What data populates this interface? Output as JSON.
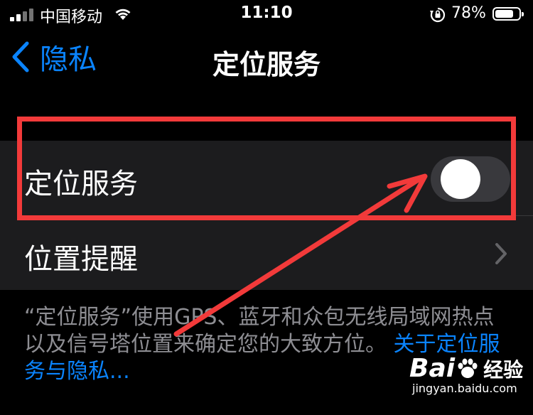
{
  "status_bar": {
    "carrier": "中国移动",
    "time": "11:10",
    "battery_percent": "78%",
    "battery_level": 0.78,
    "icons": [
      "signal-icon",
      "wifi-icon",
      "rotation-lock-icon",
      "battery-icon"
    ]
  },
  "nav": {
    "back_label": "隐私",
    "title": "定位服务",
    "back_icon": "chevron-left-icon"
  },
  "rows": {
    "location_services": {
      "label": "定位服务",
      "toggle_on": false
    },
    "location_alerts": {
      "label": "位置提醒",
      "icon": "chevron-right-icon"
    }
  },
  "footnote": {
    "text": "“定位服务”使用GPS、蓝牙和众包无线局域网热点以及信号塔位置来确定您的大致方位。",
    "link": "关于定位服务与隐私..."
  },
  "annotation": {
    "box_color": "#f23a3a",
    "arrow_color": "#f23a3a"
  },
  "watermark": {
    "brand_text": "Bai",
    "brand_text_2": "经验",
    "url": "jingyan.baidu.com"
  },
  "colors": {
    "accent": "#0a84ff",
    "background": "#000000",
    "cell": "#1c1c1e",
    "toggle_off": "#39393d",
    "secondary_text": "#8e8e93"
  }
}
